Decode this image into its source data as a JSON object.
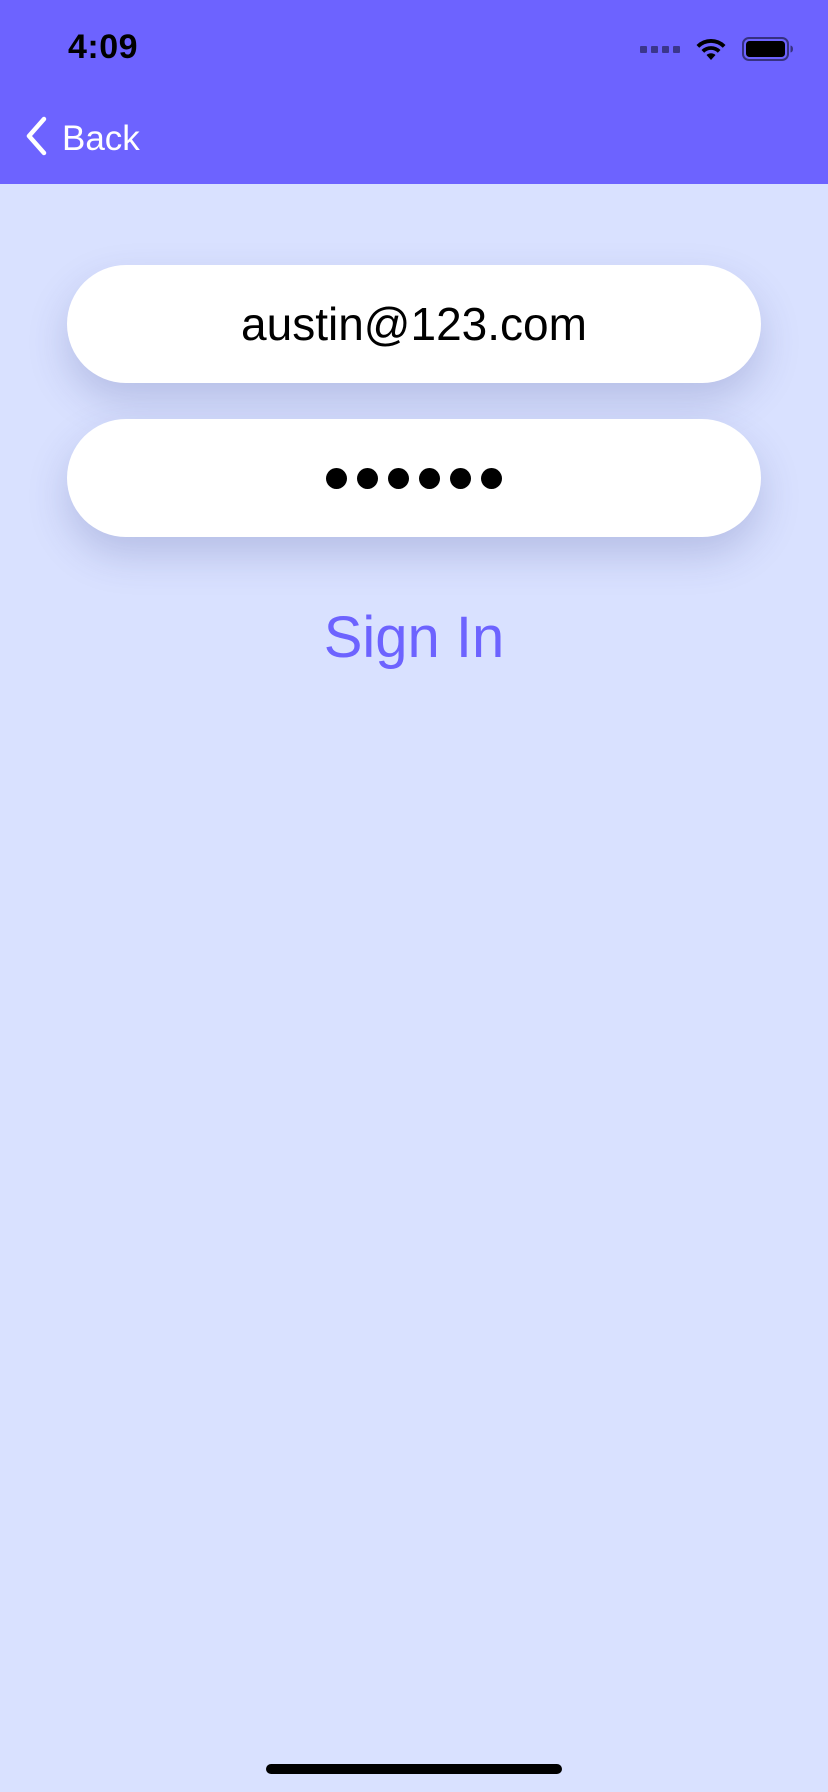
{
  "status_bar": {
    "time": "4:09"
  },
  "nav": {
    "back_label": "Back"
  },
  "form": {
    "email_value": "austin@123.com",
    "password_mask_count": 6,
    "sign_in_label": "Sign In"
  },
  "colors": {
    "header": "#6d63ff",
    "background": "#d9e1ff",
    "accent": "#6d63ff",
    "field_bg": "#ffffff"
  },
  "icons": [
    "chevron-left-icon",
    "wifi-icon",
    "battery-icon",
    "cellular-signal-icon"
  ]
}
